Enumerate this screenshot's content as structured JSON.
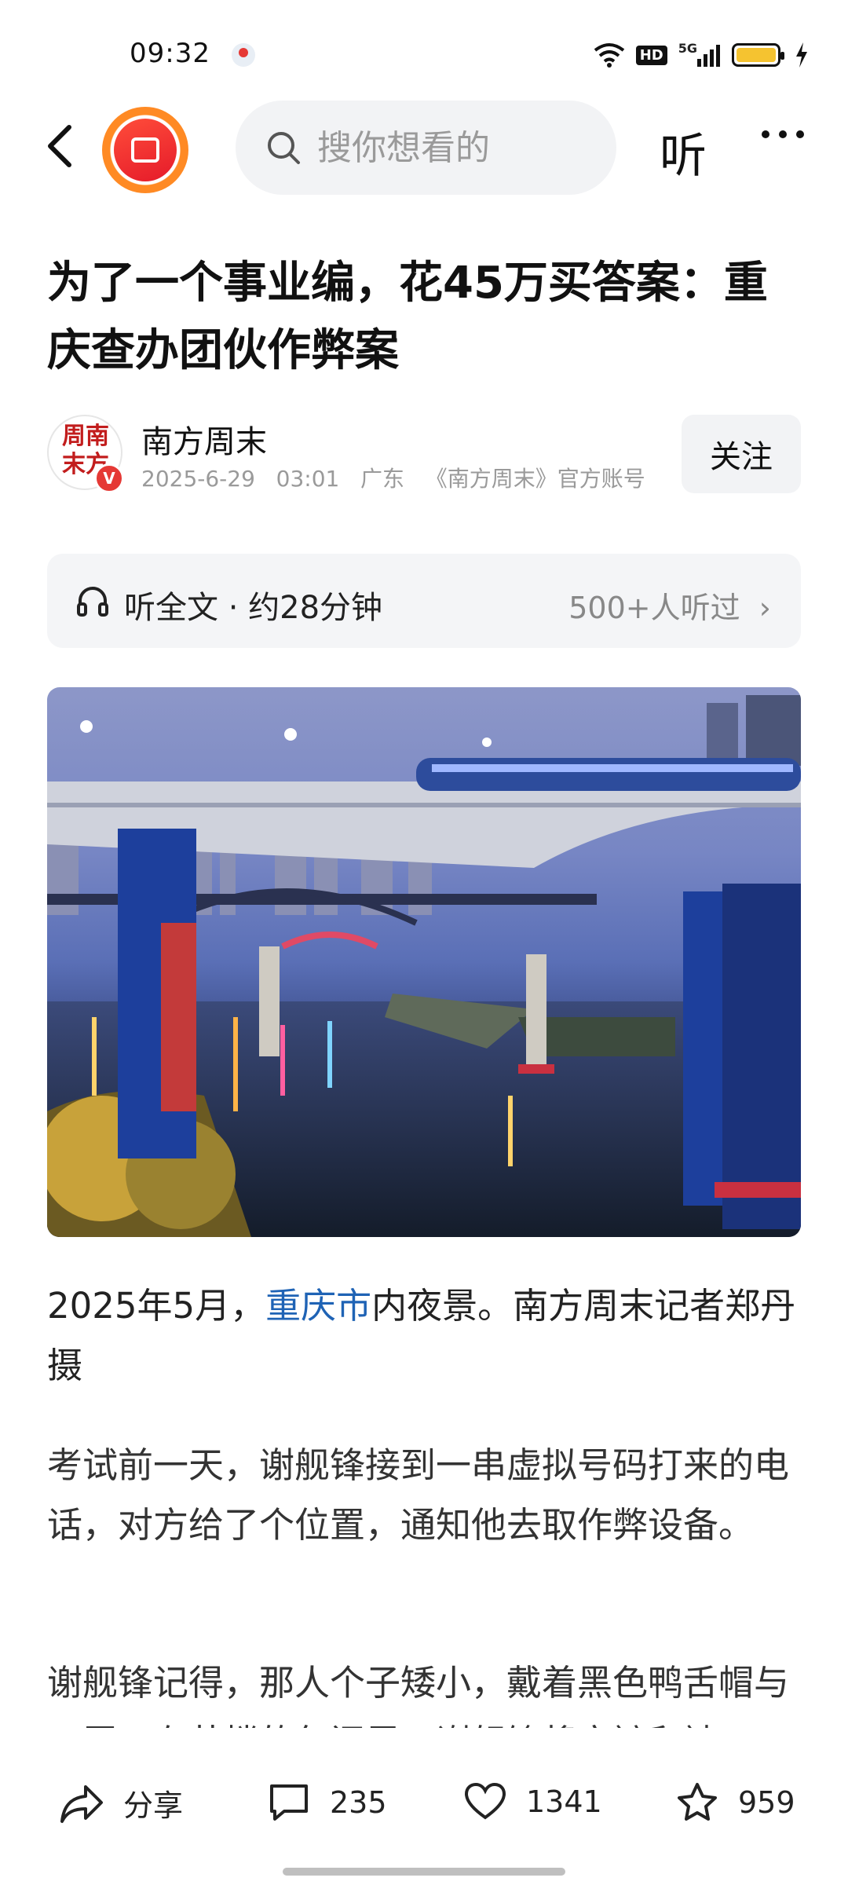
{
  "status_bar": {
    "time": "09:32",
    "network_badge": "HD",
    "network_type": "5G",
    "battery_color": "#f5c330"
  },
  "top_bar": {
    "search_placeholder": "搜你想看的",
    "listen_label": "听"
  },
  "article": {
    "title": "为了一个事业编，花45万买答案：重庆查办团伙作弊案",
    "author": {
      "name": "南方周末",
      "avatar_seal": "周南末方",
      "verified_badge": "V",
      "date": "2025-6-29",
      "time": "03:01",
      "location": "广东",
      "account_note": "《南方周末》官方账号"
    },
    "follow_label": "关注",
    "listen_bar": {
      "label": "听全文 · 约28分钟",
      "listeners": "500+人听过"
    },
    "caption_parts": {
      "before": "2025年5月，",
      "link": "重庆市",
      "after": "内夜景。南方周末记者郑丹 摄"
    },
    "paragraphs": [
      "考试前一天，谢舰锋接到一串虚拟号码打来的电话，对方给了个位置，通知他去取作弊设备。",
      "谢舰锋记得，那人个子矮小，戴着黑色鸭舌帽与口罩。在茶楼的包间里，谢舰锋将衣裤和袜"
    ]
  },
  "bottom_bar": {
    "share_label": "分享",
    "comment_count": "235",
    "like_count": "1341",
    "favorite_count": "959"
  },
  "colors": {
    "link": "#1f63b5",
    "accent_red": "#e53935",
    "logo_orange": "#ff8a24"
  }
}
